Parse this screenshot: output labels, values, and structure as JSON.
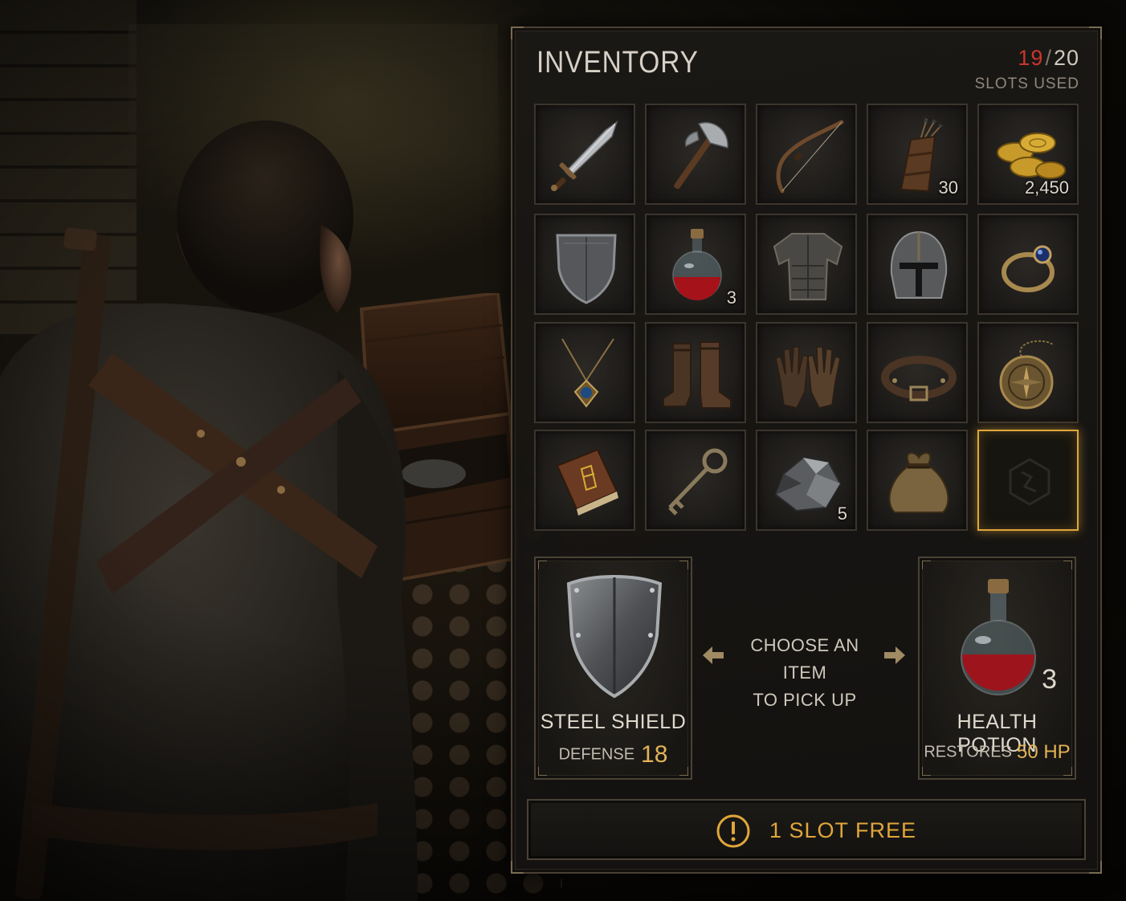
{
  "inventory": {
    "title": "INVENTORY",
    "slots_used": "19",
    "slots_separator": "/",
    "slots_total": "20",
    "slots_label": "SLOTS USED",
    "items": [
      {
        "name": "sword",
        "icon": "sword-icon",
        "qty": ""
      },
      {
        "name": "axe",
        "icon": "axe-icon",
        "qty": ""
      },
      {
        "name": "bow",
        "icon": "bow-icon",
        "qty": ""
      },
      {
        "name": "quiver",
        "icon": "quiver-icon",
        "qty": "30"
      },
      {
        "name": "gold-coins",
        "icon": "coins-icon",
        "qty": "2,450"
      },
      {
        "name": "shield",
        "icon": "shield-icon",
        "qty": ""
      },
      {
        "name": "potion",
        "icon": "potion-icon",
        "qty": "3"
      },
      {
        "name": "chest-armor",
        "icon": "armor-icon",
        "qty": ""
      },
      {
        "name": "helmet",
        "icon": "helmet-icon",
        "qty": ""
      },
      {
        "name": "ring",
        "icon": "ring-icon",
        "qty": ""
      },
      {
        "name": "amulet",
        "icon": "amulet-icon",
        "qty": ""
      },
      {
        "name": "boots",
        "icon": "boots-icon",
        "qty": ""
      },
      {
        "name": "gloves",
        "icon": "gloves-icon",
        "qty": ""
      },
      {
        "name": "belt",
        "icon": "belt-icon",
        "qty": ""
      },
      {
        "name": "compass",
        "icon": "compass-icon",
        "qty": ""
      },
      {
        "name": "book",
        "icon": "book-icon",
        "qty": ""
      },
      {
        "name": "key",
        "icon": "key-icon",
        "qty": ""
      },
      {
        "name": "ore",
        "icon": "ore-icon",
        "qty": "5"
      },
      {
        "name": "pouch",
        "icon": "pouch-icon",
        "qty": ""
      },
      {
        "name": "empty-slot",
        "icon": "empty-slot-emblem-icon",
        "qty": ""
      }
    ]
  },
  "pickup": {
    "prompt_line1": "CHOOSE AN ITEM",
    "prompt_line2": "TO PICK UP",
    "left": {
      "name": "STEEL SHIELD",
      "stat_label": "DEFENSE",
      "stat_value": "18",
      "icon": "shield-icon"
    },
    "right": {
      "name": "HEALTH POTION",
      "stat_label": "RESTORES",
      "stat_value": "50 HP",
      "qty": "3",
      "icon": "potion-icon"
    }
  },
  "footer": {
    "text": "1 SLOT FREE",
    "icon": "warning-icon"
  },
  "colors": {
    "accent_gold": "#e0a63a",
    "used_red": "#c8362c",
    "stat_gold": "#e2b257"
  }
}
